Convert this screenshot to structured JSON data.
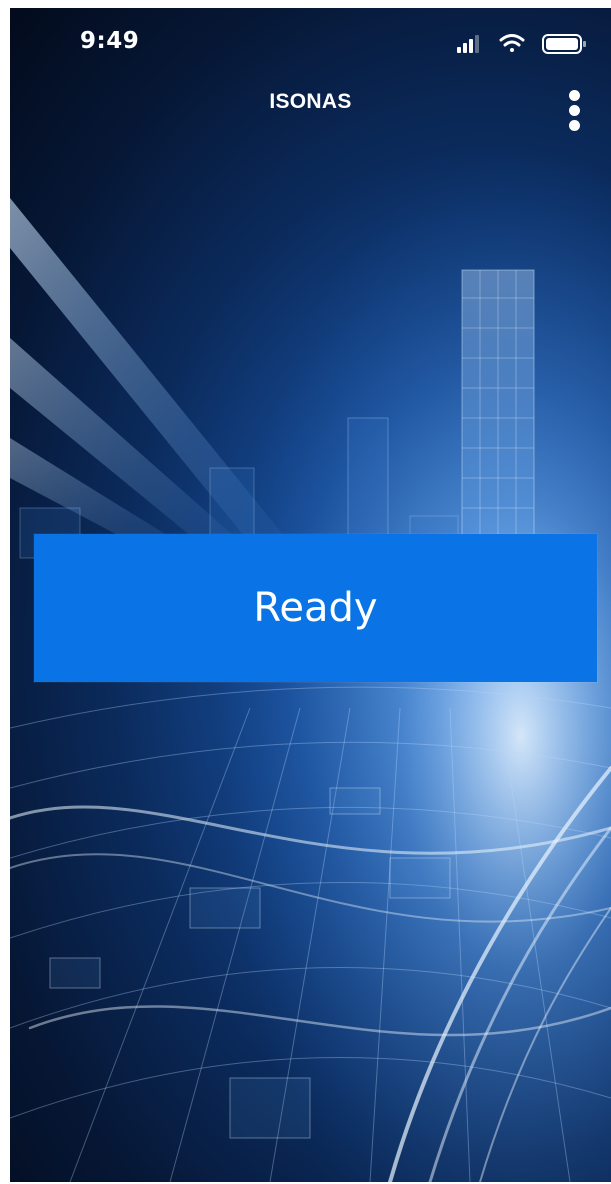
{
  "status_bar": {
    "time": "9:49",
    "icons": [
      "cellular-signal-icon",
      "wifi-icon",
      "battery-icon"
    ]
  },
  "nav": {
    "title": "ISONAS",
    "menu_icon": "more-vertical-icon"
  },
  "main": {
    "ready_label": "Ready"
  },
  "colors": {
    "button_blue": "#0a74e6",
    "background_dark": "#061735",
    "background_light": "#3f83d8",
    "text": "#ffffff"
  }
}
